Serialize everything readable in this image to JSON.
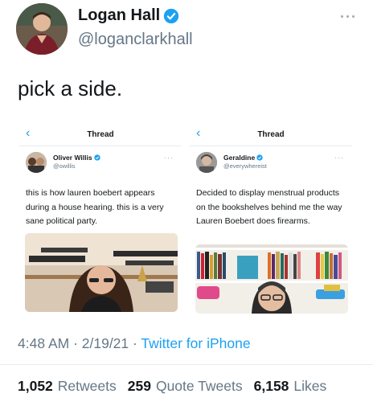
{
  "tweet": {
    "author_name": "Logan Hall",
    "author_handle": "@loganclarkhall",
    "text": "pick a side.",
    "timestamp": "4:48 AM · 2/19/21 · ",
    "source": "Twitter for iPhone",
    "stats": {
      "retweets_count": "1,052",
      "retweets_label": "Retweets",
      "quotes_count": "259",
      "quotes_label": "Quote Tweets",
      "likes_count": "6,158",
      "likes_label": "Likes"
    }
  },
  "screenshots": [
    {
      "back": "‹",
      "title": "Thread",
      "name": "Oliver Willis",
      "handle": "@owillis",
      "more": "···",
      "text": "this is how lauren boebert appears during a house hearing. this is a very sane political party."
    },
    {
      "back": "‹",
      "title": "Thread",
      "name": "Geraldine",
      "handle": "@everywhereist",
      "more": "···",
      "text": "Decided to display menstrual products on the bookshelves behind me the way Lauren Boebert does firearms."
    }
  ],
  "colors": {
    "accent": "#1da1f2",
    "secondary_text": "#657786",
    "primary_text": "#14171a"
  }
}
